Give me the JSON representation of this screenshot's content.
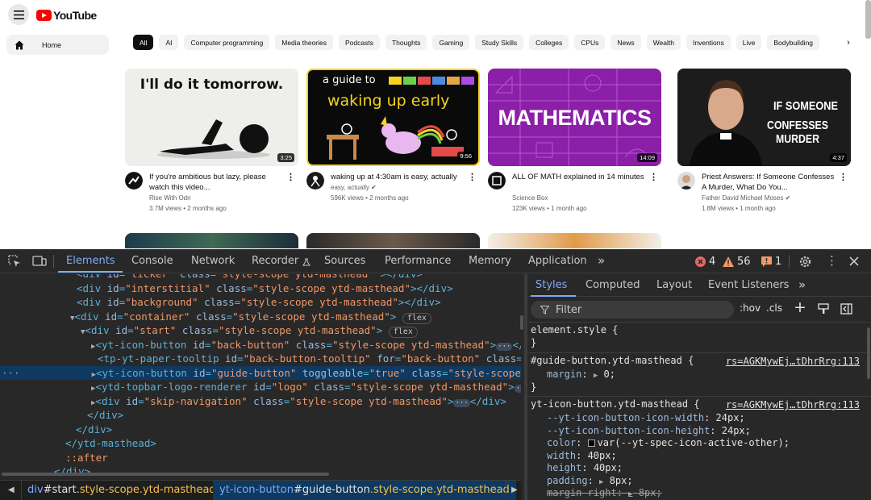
{
  "youtube": {
    "logo_text": "YouTube",
    "sidebar_home": "Home",
    "chips": [
      "All",
      "AI",
      "Computer programming",
      "Media theories",
      "Podcasts",
      "Thoughts",
      "Gaming",
      "Study Skills",
      "Colleges",
      "CPUs",
      "News",
      "Wealth",
      "Inventions",
      "Live",
      "Bodybuilding"
    ],
    "videos": [
      {
        "thumb_text": "I'll do it tomorrow.",
        "duration": "3:25",
        "title": "If you're ambitious but lazy, please watch this video...",
        "channel": "Rise With Odn",
        "views": "3.7M views • 2 months ago",
        "verified": false
      },
      {
        "thumb_text_top": "a guide to",
        "thumb_text_main": "waking up early",
        "duration": "9:56",
        "title": "waking up at 4:30am is easy, actually",
        "channel": "easy, actually",
        "views": "596K views • 2 months ago",
        "verified": true
      },
      {
        "thumb_text": "MATHEMATICS",
        "duration": "14:09",
        "title": "ALL OF MATH explained in 14 minutes",
        "channel": "Science Box",
        "views": "123K views • 1 month ago",
        "verified": false
      },
      {
        "thumb_text_1": "IF SOMEONE",
        "thumb_text_2": "CONFESSES MURDER",
        "duration": "4:37",
        "title": "Priest Answers: If Someone Confesses A Murder, What Do You...",
        "channel": "Father David Michael Moses",
        "views": "1.8M views • 1 month ago",
        "verified": true
      }
    ]
  },
  "devtools": {
    "tabs": [
      "Elements",
      "Console",
      "Network",
      "Recorder",
      "Sources",
      "Performance",
      "Memory",
      "Application"
    ],
    "more_tabs": "»",
    "errors": "4",
    "warnings": "56",
    "issues": "1",
    "breadcrumbs": [
      {
        "tag": "div",
        "rest": "#start",
        ".cls": ".style-scope.ytd-masthead"
      },
      {
        "tag": "yt-icon-button",
        "rest": "#guide-button",
        ".cls": ".style-scope.ytd-masthead"
      }
    ],
    "styles_tabs": [
      "Styles",
      "Computed",
      "Layout",
      "Event Listeners"
    ],
    "filter_placeholder": "Filter",
    "hov": ":hov",
    "cls": ".cls",
    "rules": {
      "element_style": "element.style {",
      "close": "}",
      "rule1_selector": "#guide-button.ytd-masthead {",
      "rule1_source": "rs=AGKMywEj…tDhrRrg:113",
      "rule1_prop": "margin",
      "rule1_val": "0;",
      "rule2_selector": "yt-icon-button.ytd-masthead {",
      "rule2_source": "rs=AGKMywEj…tDhrRrg:113",
      "rule2_props": [
        {
          "p": "--yt-icon-button-icon-width",
          "v": "24px;"
        },
        {
          "p": "--yt-icon-button-icon-height",
          "v": "24px;"
        },
        {
          "p": "color",
          "v": "var(--yt-spec-icon-active-other);"
        },
        {
          "p": "width",
          "v": "40px;"
        },
        {
          "p": "height",
          "v": "40px;"
        },
        {
          "p": "padding",
          "v": "8px;"
        },
        {
          "p": "margin-right",
          "v": "8px;"
        }
      ]
    },
    "flex_badge": "flex",
    "row_marker": "···"
  }
}
